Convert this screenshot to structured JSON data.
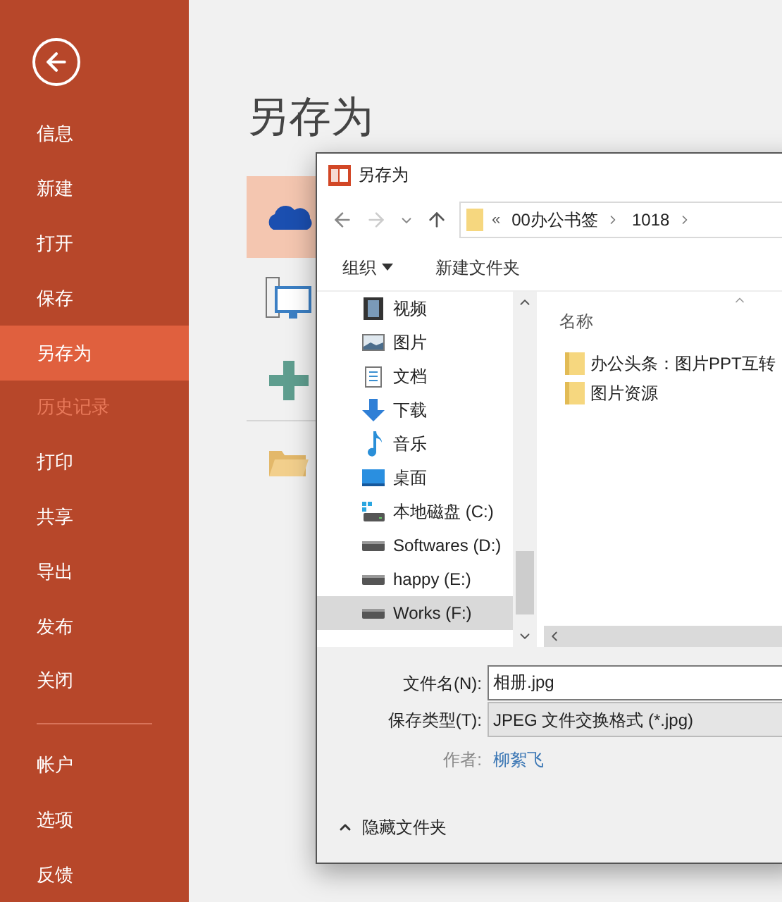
{
  "backstage": {
    "nav_top": [
      {
        "label": "信息",
        "selected": false,
        "disabled": false
      },
      {
        "label": "新建",
        "selected": false,
        "disabled": false
      },
      {
        "label": "打开",
        "selected": false,
        "disabled": false
      },
      {
        "label": "保存",
        "selected": false,
        "disabled": false
      },
      {
        "label": "另存为",
        "selected": true,
        "disabled": false
      },
      {
        "label": "历史记录",
        "selected": false,
        "disabled": true
      },
      {
        "label": "打印",
        "selected": false,
        "disabled": false
      },
      {
        "label": "共享",
        "selected": false,
        "disabled": false
      },
      {
        "label": "导出",
        "selected": false,
        "disabled": false
      },
      {
        "label": "发布",
        "selected": false,
        "disabled": false
      },
      {
        "label": "关闭",
        "selected": false,
        "disabled": false
      }
    ],
    "nav_bottom": [
      {
        "label": "帐户",
        "selected": false,
        "disabled": false
      },
      {
        "label": "选项",
        "selected": false,
        "disabled": false
      },
      {
        "label": "反馈",
        "selected": false,
        "disabled": false
      }
    ]
  },
  "page_title": "另存为",
  "locations": [
    {
      "kind": "cloud",
      "selected": true
    },
    {
      "kind": "computer",
      "selected": false
    },
    {
      "kind": "add",
      "selected": false
    },
    {
      "kind": "browse",
      "selected": false
    }
  ],
  "dialog": {
    "title": "另存为",
    "breadcrumb": {
      "overflow": "«",
      "parts": [
        "00办公书签",
        "1018"
      ]
    },
    "toolbar": [
      {
        "label": "组织",
        "dropdown": true
      },
      {
        "label": "新建文件夹",
        "dropdown": false
      }
    ],
    "tree": [
      {
        "label": "视频",
        "kind": "video",
        "selected": false
      },
      {
        "label": "图片",
        "kind": "pictures",
        "selected": false
      },
      {
        "label": "文档",
        "kind": "document",
        "selected": false
      },
      {
        "label": "下载",
        "kind": "download",
        "selected": false
      },
      {
        "label": "音乐",
        "kind": "music",
        "selected": false
      },
      {
        "label": "桌面",
        "kind": "desktop",
        "selected": false
      },
      {
        "label": "本地磁盘 (C:)",
        "kind": "system-drive",
        "selected": false
      },
      {
        "label": "Softwares (D:)",
        "kind": "drive",
        "selected": false
      },
      {
        "label": "happy (E:)",
        "kind": "drive",
        "selected": false
      },
      {
        "label": "Works (F:)",
        "kind": "drive",
        "selected": true
      }
    ],
    "column_header": "名称",
    "files": [
      "办公头条：图片PPT互转",
      "图片资源"
    ],
    "fields": [
      {
        "label": "文件名(N):",
        "value": "相册.jpg",
        "kind": "input"
      },
      {
        "label": "保存类型(T):",
        "value": "JPEG 文件交换格式 (*.jpg)",
        "kind": "select"
      }
    ],
    "author": {
      "label": "作者:",
      "value": "柳絮飞"
    },
    "hide_folders": "隐藏文件夹"
  }
}
